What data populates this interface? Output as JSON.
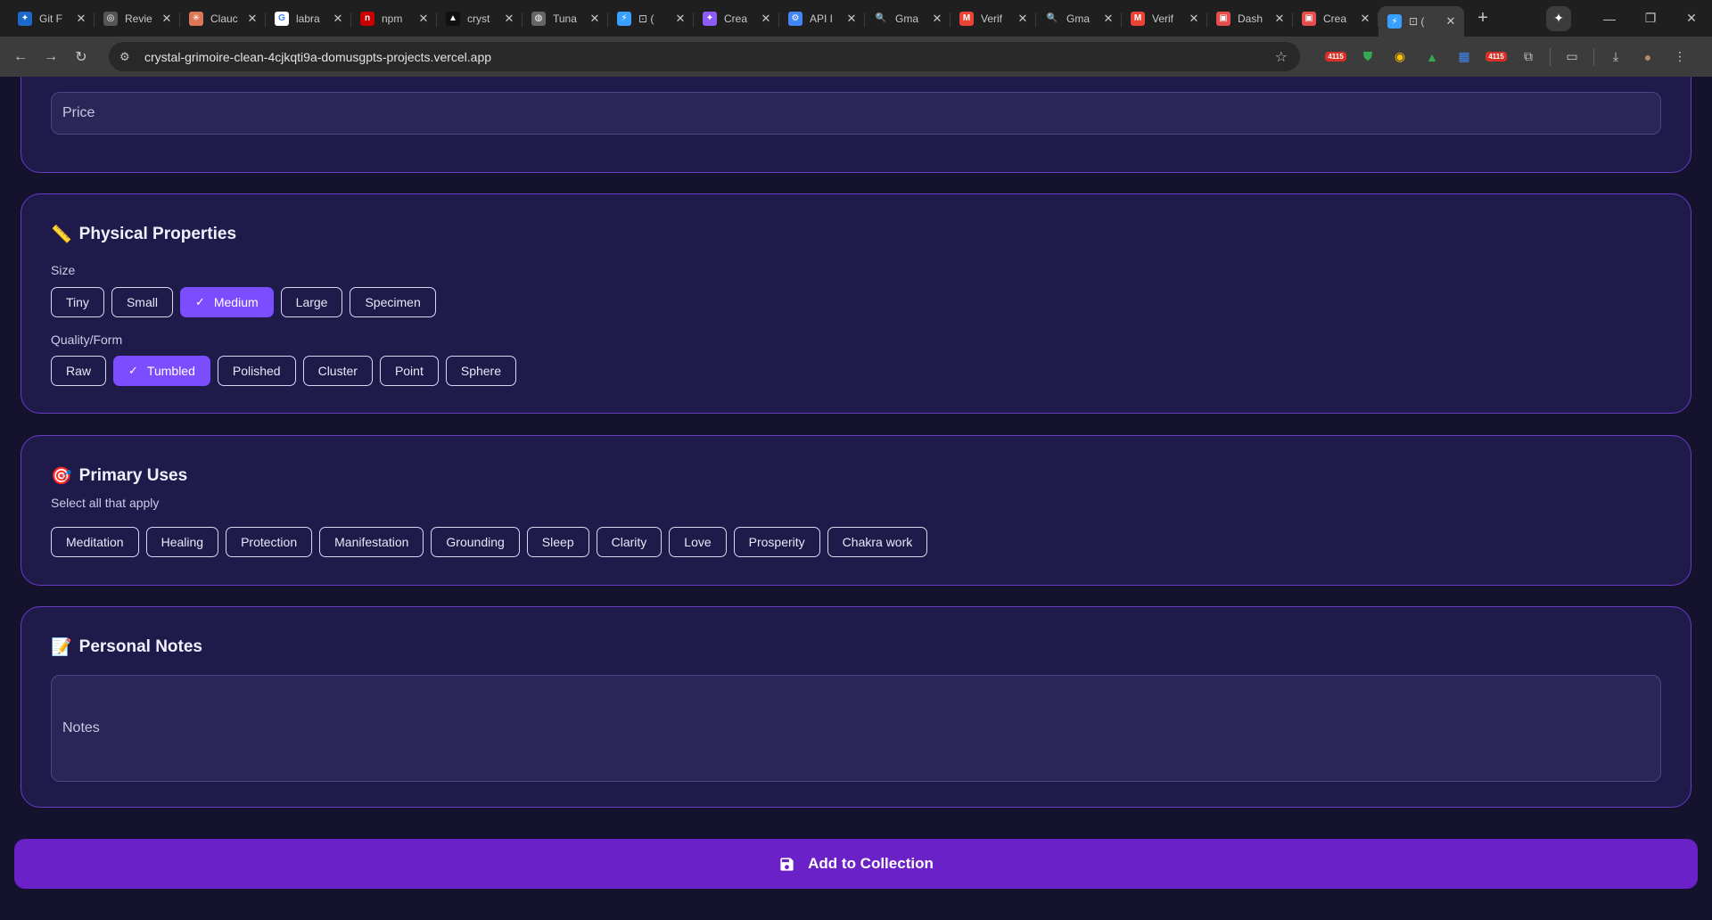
{
  "browser": {
    "tabs": [
      {
        "label": "Git F",
        "color": "#1b6ac9",
        "glyph": "✦"
      },
      {
        "label": "Revie",
        "color": "#555555",
        "glyph": "◎"
      },
      {
        "label": "Clauc",
        "color": "#d97757",
        "glyph": "✳"
      },
      {
        "label": "labra",
        "color": "#ffffff",
        "glyph": "G"
      },
      {
        "label": "npm",
        "color": "#cb0000",
        "glyph": "n"
      },
      {
        "label": "cryst",
        "color": "#111111",
        "glyph": "▲"
      },
      {
        "label": "Tuna",
        "color": "#666666",
        "glyph": "◍"
      },
      {
        "label": "⊡ (",
        "color": "#3aa0ff",
        "glyph": "⚡"
      },
      {
        "label": "Crea",
        "color": "#8b5cf6",
        "glyph": "✦"
      },
      {
        "label": "API I",
        "color": "#4285f4",
        "glyph": "⚙"
      },
      {
        "label": "Gma",
        "color": "#1f1f1f",
        "glyph": "🔍"
      },
      {
        "label": "Verif",
        "color": "#ea4335",
        "glyph": "M"
      },
      {
        "label": "Gma",
        "color": "#1f1f1f",
        "glyph": "🔍"
      },
      {
        "label": "Verif",
        "color": "#ea4335",
        "glyph": "M"
      },
      {
        "label": "Dash",
        "color": "#e34d4d",
        "glyph": "▣"
      },
      {
        "label": "Crea",
        "color": "#e34d4d",
        "glyph": "▣"
      },
      {
        "label": "⊡ (",
        "color": "#3aa0ff",
        "glyph": "⚡",
        "active": true
      }
    ],
    "new_tab": "+",
    "url": "crystal-grimoire-clean-4cjkqti9a-domusgpts-projects.vercel.app",
    "badge": "4115"
  },
  "form": {
    "price_placeholder": "Price",
    "physical": {
      "emoji": "📏",
      "title": "Physical Properties",
      "size_label": "Size",
      "sizes": [
        "Tiny",
        "Small",
        "Medium",
        "Large",
        "Specimen"
      ],
      "size_selected": "Medium",
      "quality_label": "Quality/Form",
      "qualities": [
        "Raw",
        "Tumbled",
        "Polished",
        "Cluster",
        "Point",
        "Sphere"
      ],
      "quality_selected": "Tumbled"
    },
    "uses": {
      "emoji": "🎯",
      "title": "Primary Uses",
      "subtitle": "Select all that apply",
      "items": [
        "Meditation",
        "Healing",
        "Protection",
        "Manifestation",
        "Grounding",
        "Sleep",
        "Clarity",
        "Love",
        "Prosperity",
        "Chakra work"
      ]
    },
    "notes": {
      "emoji": "📝",
      "title": "Personal Notes",
      "placeholder": "Notes"
    },
    "submit_label": "Add to Collection"
  },
  "colors": {
    "accent": "#7c4dff",
    "card_border": "#6a3bc7",
    "button": "#6b21c8"
  }
}
